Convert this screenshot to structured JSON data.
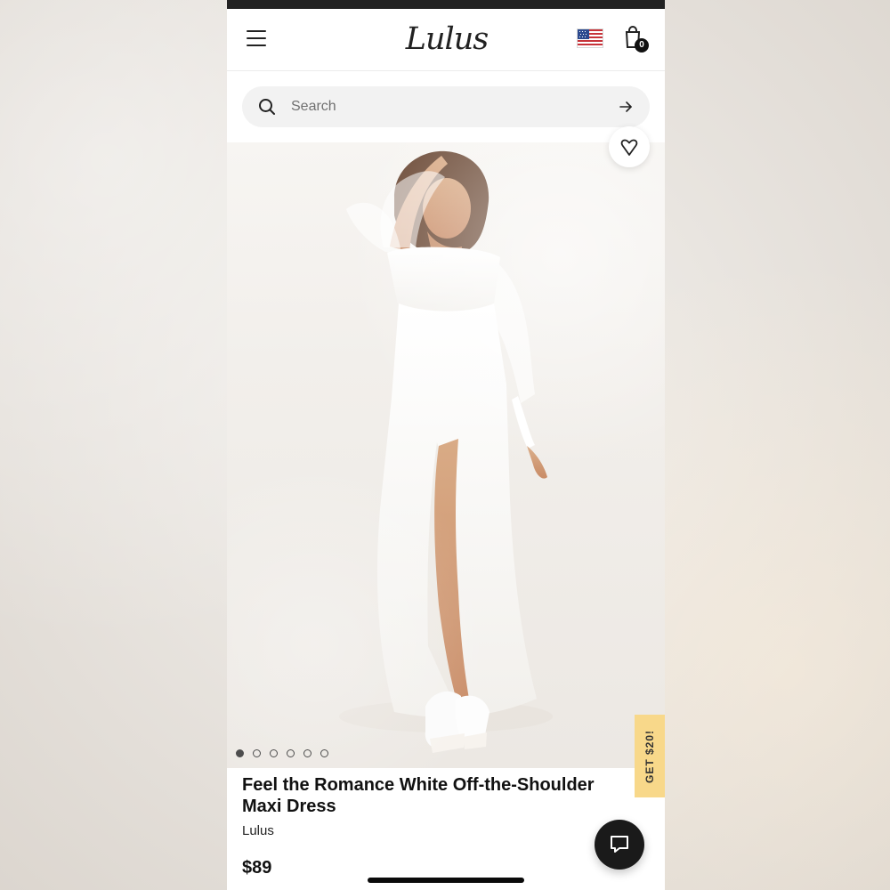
{
  "header": {
    "logo": "Lulus",
    "cart_count": "0",
    "flag_icon": "us-flag-icon",
    "menu_icon": "hamburger-menu-icon",
    "bag_icon": "shopping-bag-icon"
  },
  "search": {
    "placeholder": "Search",
    "icon": "search-icon",
    "submit_icon": "arrow-right-icon"
  },
  "hero": {
    "favorite_icon": "heart-icon",
    "carousel": {
      "count": 6,
      "active_index": 0
    }
  },
  "promo": {
    "label": "GET $20!"
  },
  "product": {
    "title": "Feel the Romance White Off-the-Shoulder Maxi Dress",
    "brand": "Lulus",
    "price": "$89"
  },
  "chat": {
    "icon": "chat-bubble-icon"
  },
  "colors": {
    "promo_bg": "#f8d88a",
    "accent_dark": "#111111"
  }
}
